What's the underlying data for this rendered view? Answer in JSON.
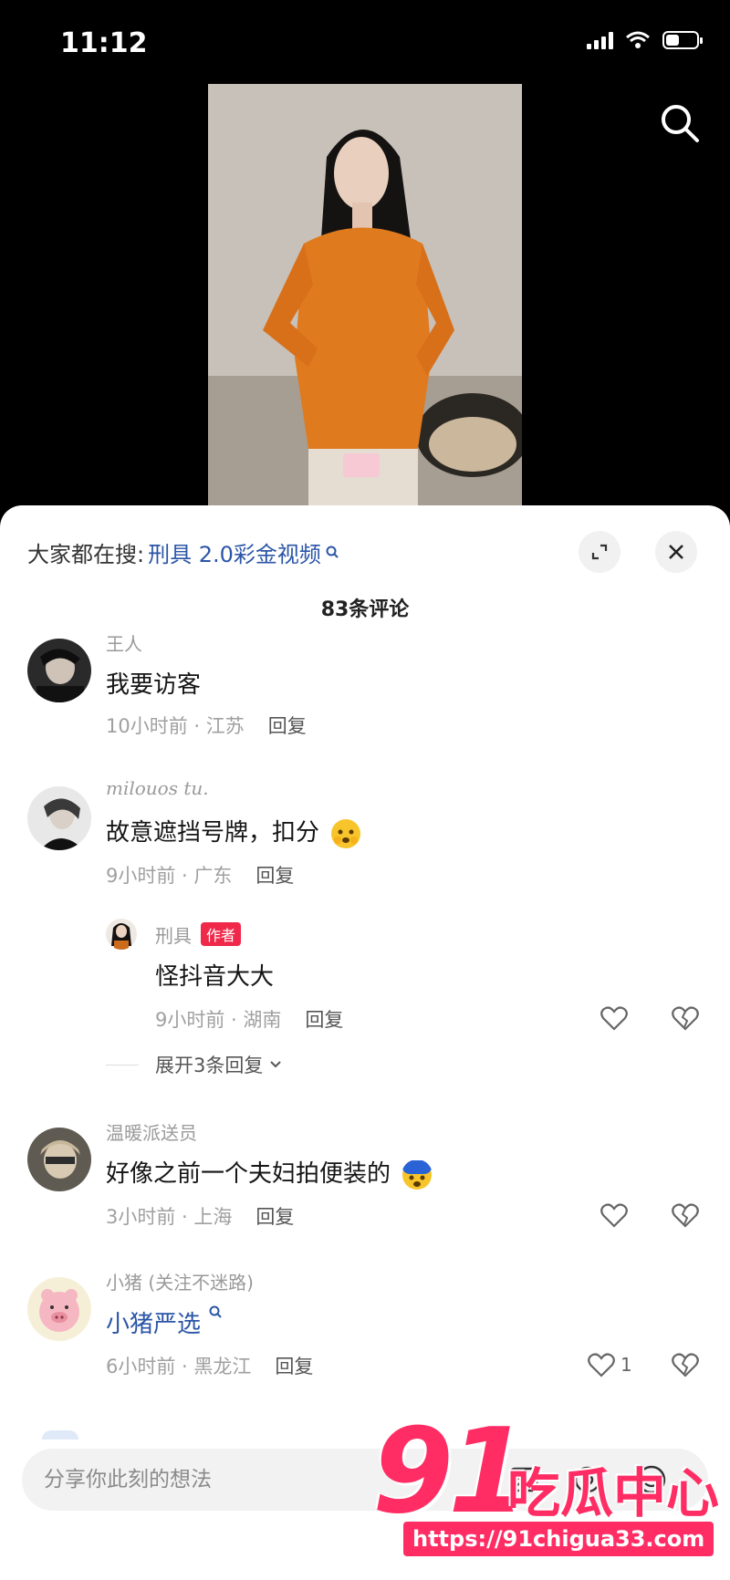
{
  "status_bar": {
    "time": "11:12",
    "battery_level": 0.45
  },
  "header": {
    "search_prefix": "大家都在搜:",
    "search_term": "刑具 2.0彩金视频",
    "comment_count": "83条评论"
  },
  "comments": [
    {
      "user": "王人",
      "text": "我要访客",
      "time_location": "10小时前 · 江苏",
      "reply": "回复"
    },
    {
      "user": "milouos tu.",
      "text": "故意遮挡号牌，扣分",
      "time_location": "9小时前 · 广东",
      "reply": "回复",
      "sub_reply": {
        "user": "刑具",
        "badge": "作者",
        "text": "怪抖音大大",
        "time_location": "9小时前 · 湖南",
        "reply": "回复"
      },
      "expand": "展开3条回复"
    },
    {
      "user": "温暖派送员",
      "text": "好像之前一个夫妇拍便装的",
      "time_location": "3小时前 · 上海",
      "reply": "回复"
    },
    {
      "user": "小猪 (关注不迷路)",
      "text": "小猪严选",
      "time_location": "6小时前 · 黑龙江",
      "reply": "回复",
      "likes": "1"
    }
  ],
  "input": {
    "placeholder": "分享你此刻的想法"
  },
  "watermark": {
    "number": "91",
    "brand": "吃瓜中心",
    "url": "https://91chigua33.com"
  }
}
